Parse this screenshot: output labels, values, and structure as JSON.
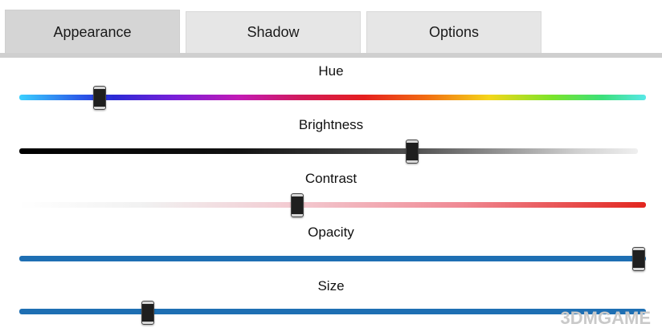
{
  "tabs": [
    {
      "label": "Appearance",
      "active": true
    },
    {
      "label": "Shadow",
      "active": false
    },
    {
      "label": "Options",
      "active": false
    }
  ],
  "sliders": [
    {
      "label": "Hue",
      "value_fraction": 0.13
    },
    {
      "label": "Brightness",
      "value_fraction": 0.63
    },
    {
      "label": "Contrast",
      "value_fraction": 0.44
    },
    {
      "label": "Opacity",
      "value_fraction": 1.0
    },
    {
      "label": "Size",
      "value_fraction": 0.2
    }
  ],
  "watermark": "3DMGAME",
  "colors": {
    "tab_active_bg": "#d5d5d5",
    "tab_bg": "#e6e6e6",
    "accent_blue": "#1e6fb3"
  }
}
